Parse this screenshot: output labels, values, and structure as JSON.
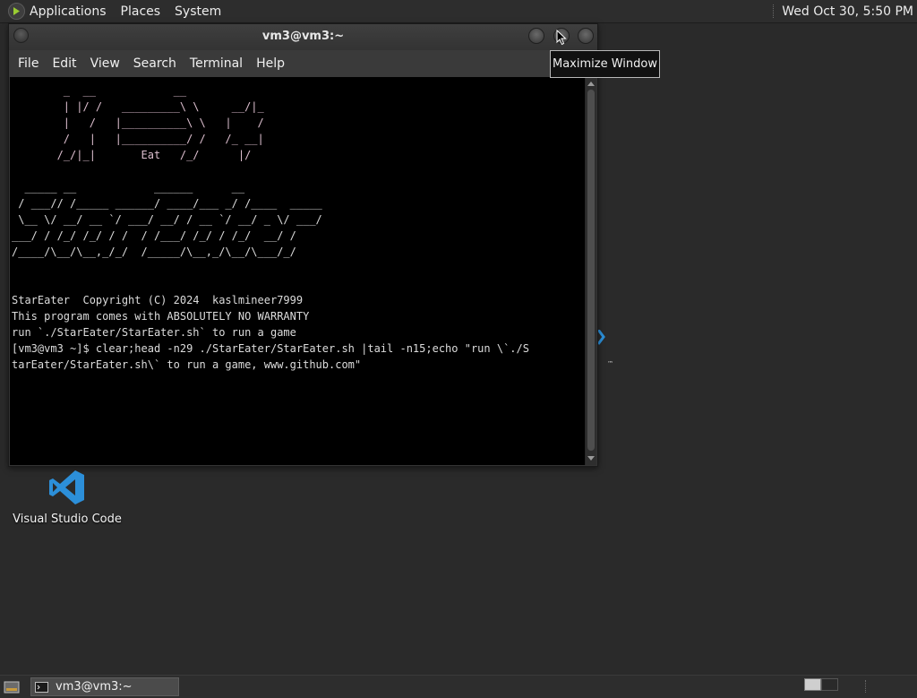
{
  "top_panel": {
    "menus": [
      "Applications",
      "Places",
      "System"
    ],
    "clock": "Wed Oct 30,  5:50 PM"
  },
  "window": {
    "title": "vm3@vm3:~",
    "menu": [
      "File",
      "Edit",
      "View",
      "Search",
      "Terminal",
      "Help"
    ]
  },
  "terminal": {
    "ascii_top": [
      "        _  __            __",
      "        | |/ /   _________\\ \\     __/|_",
      "        |   /   |__________\\ \\   |    /",
      "        /   |   |__________/ /   /_ __|",
      "       /_/|_|       Eat   /_/      |/"
    ],
    "ascii_logo": [
      "  _____ __            ______      __",
      " / ___// /_____ ______/ ____/___ _/ /____  _____",
      " \\__ \\/ __/ __ `/ ___/ __/ / __ `/ __/ _ \\/ ___/",
      "___/ / /_/ /_/ / /  / /___/ /_/ / /_/  __/ /",
      "/____/\\__/\\__,_/_/  /_____/\\__,_/\\__/\\___/_/"
    ],
    "info": [
      "StarEater  Copyright (C) 2024  kaslmineer7999",
      "This program comes with ABSOLUTELY NO WARRANTY",
      "run `./StarEater/StarEater.sh` to run a game",
      "[vm3@vm3 ~]$ clear;head -n29 ./StarEater/StarEater.sh |tail -n15;echo \"run \\`./S",
      "tarEater/StarEater.sh\\` to run a game, www.github.com\""
    ]
  },
  "tooltip": "Maximize Window",
  "desktop": {
    "icon_label": "Visual Studio Code"
  },
  "taskbar": {
    "task_label": "vm3@vm3:~"
  },
  "colors": {
    "vscode_blue": "#2c8fd9",
    "ascii_pink": "#ddbfcf"
  }
}
